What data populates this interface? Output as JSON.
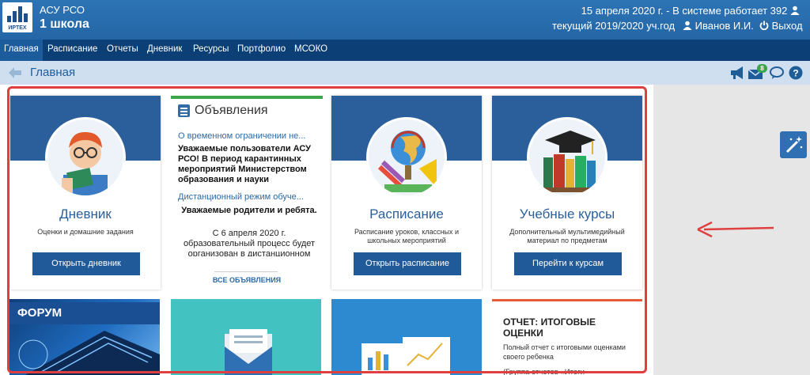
{
  "header": {
    "logo_text": "ИРТЕХ",
    "app_name": "АСУ РСО",
    "school": "1 школа",
    "date_status": "15 апреля 2020 г. - В системе работает 392",
    "year": "текущий 2019/2020 уч.год",
    "user": "Иванов И.И.",
    "logout": "Выход"
  },
  "nav": {
    "items": [
      "Главная",
      "Расписание",
      "Отчеты",
      "Дневник",
      "Ресурсы",
      "Портфолио",
      "МСОКО"
    ],
    "active": "Главная"
  },
  "breadcrumb": {
    "title": "Главная",
    "mail_badge": "8"
  },
  "cards": [
    {
      "title": "Дневник",
      "desc": "Оценки и домашние задания",
      "button": "Открыть дневник"
    },
    {
      "title": "Расписание",
      "desc": "Расписание уроков, классных и школьных мероприятий",
      "button": "Открыть расписание"
    },
    {
      "title": "Учебные курсы",
      "desc": "Дополнительный мультимедийный материал по предметам",
      "button": "Перейти к курсам"
    }
  ],
  "announcements": {
    "title": "Объявления",
    "item1_title": "О временном ограничении не...",
    "item1_text": "Уважаемые пользователи АСУ РСО! В период карантинных мероприятий Министерством образования и науки",
    "item2_title": "Дистанционный режим обуче...",
    "item2_greeting": "Уважаемые родители и ребята.",
    "item2_text": "С 6 апреля 2020 г. образовательный процесс будет организован в дистанционном",
    "all_link": "ВСЕ ОБЪЯВЛЕНИЯ"
  },
  "tiles": {
    "forum": "ФОРУМ",
    "report_title": "ОТЧЕТ: ИТОГОВЫЕ ОЦЕНКИ",
    "report_desc": "Полный отчет с итоговыми оценками своего ребенка",
    "report_more": "(Группа отчетов «Итоги"
  },
  "icons": [
    "back-arrow-icon",
    "megaphone-icon",
    "mail-icon",
    "chat-icon",
    "help-icon",
    "magic-wand-icon",
    "user-icon",
    "power-icon"
  ]
}
